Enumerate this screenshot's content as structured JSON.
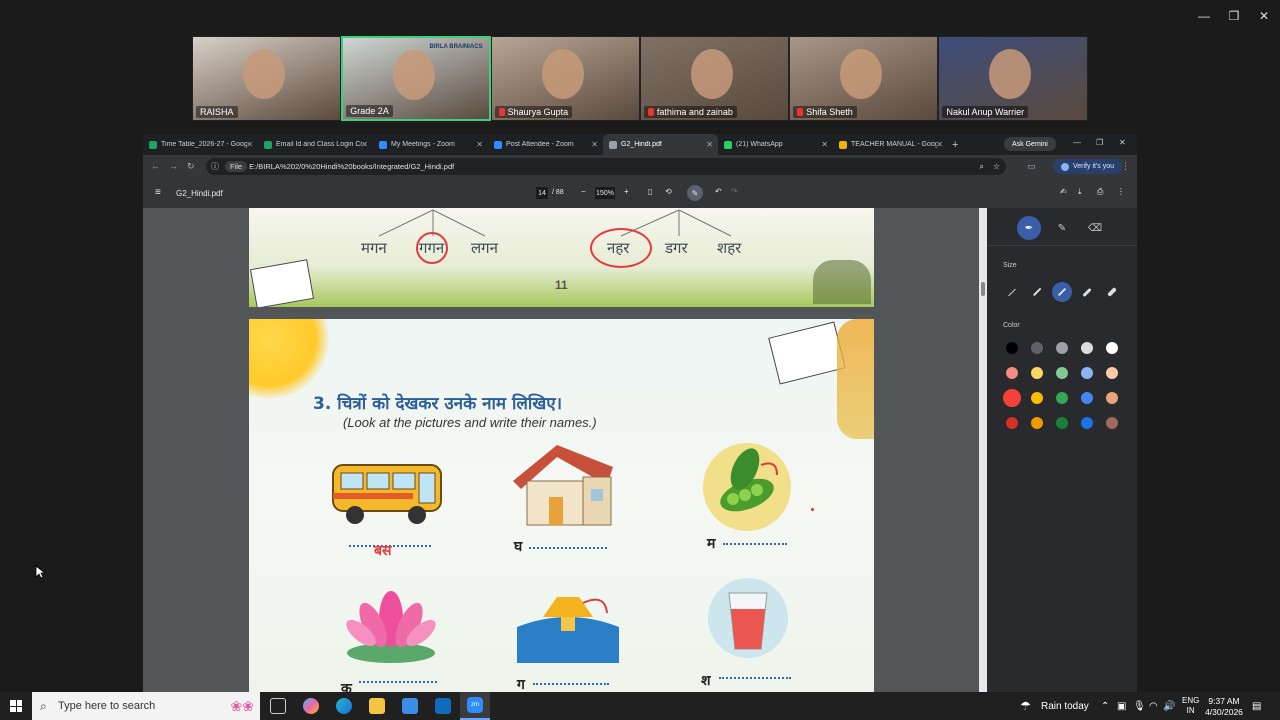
{
  "zoom": {
    "participants": [
      {
        "name": "RAISHA",
        "muted": false,
        "bg": "#d9cfc6"
      },
      {
        "name": "Grade 2A",
        "muted": false,
        "bg": "#cfd6d4",
        "active": true,
        "banner": "BIRLA BRAINIACS"
      },
      {
        "name": "Shaurya Gupta",
        "muted": true,
        "bg": "#b9a594"
      },
      {
        "name": "fathima and zainab",
        "muted": true,
        "bg": "#7f7165"
      },
      {
        "name": "Shifa Sheth",
        "muted": true,
        "bg": "#a89686"
      },
      {
        "name": "Nakul Anup Warrier",
        "muted": false,
        "bg": "#3e4d7a"
      }
    ],
    "window_controls": [
      "—",
      "❐",
      "✕"
    ]
  },
  "browser": {
    "tabs": [
      {
        "label": "Time Table_2026-27 - Googl",
        "color": "#1ea362"
      },
      {
        "label": "Email Id and Class Login Cre",
        "color": "#1ea362"
      },
      {
        "label": "My Meetings - Zoom",
        "color": "#2d8cff"
      },
      {
        "label": "Post Attendee - Zoom",
        "color": "#2d8cff"
      },
      {
        "label": "G2_Hindi.pdf",
        "color": "#9aa0a6",
        "active": true
      },
      {
        "label": "(21) WhatsApp",
        "color": "#25d366"
      },
      {
        "label": "TEACHER MANUAL - Googl",
        "color": "#f4b400"
      }
    ],
    "new_tab": "+",
    "ask_gemini": "Ask Gemini",
    "address": {
      "chip": "File",
      "url": "E:/BIRLA%202/0%20Hindi%20books/Integrated/G2_Hindi.pdf"
    },
    "verify": "Verify it's you"
  },
  "pdf": {
    "filename": "G2_Hindi.pdf",
    "page_current": "14",
    "page_total": "/ 88",
    "zoom": "150%",
    "top_words": [
      "मगन",
      "गगन",
      "लगन",
      "नहर",
      "डगर",
      "शहर"
    ],
    "page_number": "11",
    "question_title": "3.  चित्रों को देखकर उनके नाम लिखिए।",
    "question_sub": "(Look at the pictures and write their names.)",
    "items": [
      {
        "prefix": "",
        "answer": "बस"
      },
      {
        "prefix": "घ",
        "answer": ""
      },
      {
        "prefix": "म",
        "answer": ""
      },
      {
        "prefix": "क",
        "answer": ""
      },
      {
        "prefix": "ग",
        "answer": ""
      },
      {
        "prefix": "श",
        "answer": ""
      }
    ]
  },
  "annotation": {
    "size_label": "Size",
    "color_label": "Color",
    "colors": [
      "#000000",
      "#5f6368",
      "#9aa0a6",
      "#dadce0",
      "#ffffff",
      "#f28b82",
      "#fdd663",
      "#81c995",
      "#8ab4f8",
      "#fcc9a7",
      "#f44336",
      "#fbbc04",
      "#34a853",
      "#4285f4",
      "#e8a27c",
      "#d93025",
      "#f29900",
      "#188038",
      "#1a73e8",
      "#a0695b"
    ]
  },
  "taskbar": {
    "search_placeholder": "Type here to search",
    "weather": "Rain today",
    "lang1": "ENG",
    "lang2": "IN",
    "time": "9:37 AM",
    "date": "4/30/2026"
  }
}
